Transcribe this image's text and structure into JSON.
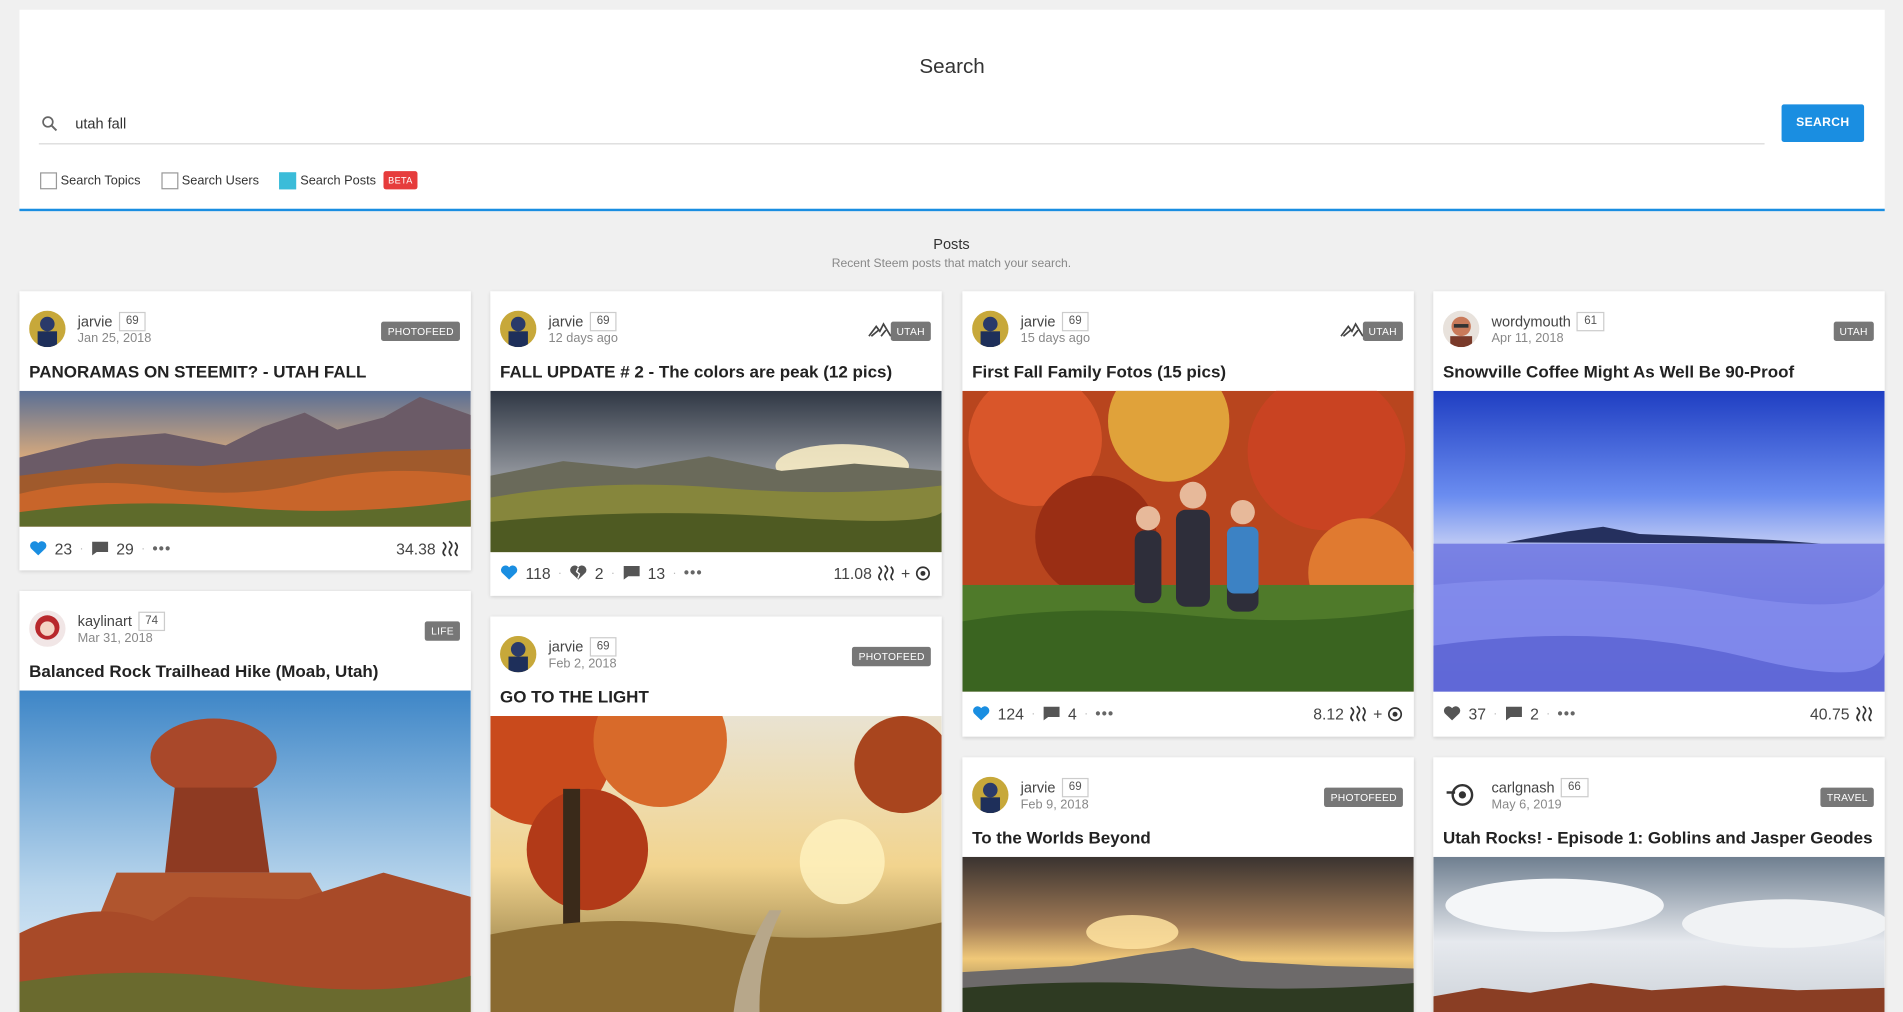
{
  "search": {
    "title": "Search",
    "query": "utah fall",
    "button_label": "SEARCH",
    "filters": [
      {
        "label": "Search Topics",
        "checked": false
      },
      {
        "label": "Search Users",
        "checked": false
      },
      {
        "label": "Search Posts",
        "checked": true,
        "badge": "BETA"
      }
    ]
  },
  "posts_section": {
    "title": "Posts",
    "subtitle": "Recent Steem posts that match your search."
  },
  "cards": [
    {
      "author": "jarvie",
      "rep": "69",
      "date": "Jan 25, 2018",
      "tag": "PHOTOFEED",
      "title": "PANORAMAS ON STEEMIT? - UTAH FALL",
      "votes": "23",
      "comments": "29",
      "payout": "34.38"
    },
    {
      "author": "jarvie",
      "rep": "69",
      "date": "12 days ago",
      "tag": "UTAH",
      "title": "FALL UPDATE # 2 - The colors are peak (12 pics)",
      "votes": "118",
      "downvotes": "2",
      "comments": "13",
      "payout": "11.08"
    },
    {
      "author": "jarvie",
      "rep": "69",
      "date": "15 days ago",
      "tag": "UTAH",
      "title": "First Fall Family Fotos (15 pics)",
      "votes": "124",
      "comments": "4",
      "payout": "8.12"
    },
    {
      "author": "wordymouth",
      "rep": "61",
      "date": "Apr 11, 2018",
      "tag": "UTAH",
      "title": "Snowville Coffee Might As Well Be 90-Proof",
      "votes": "37",
      "comments": "2",
      "payout": "40.75"
    },
    {
      "author": "kaylinart",
      "rep": "74",
      "date": "Mar 31, 2018",
      "tag": "LIFE",
      "title": "Balanced Rock Trailhead Hike (Moab, Utah)"
    },
    {
      "author": "jarvie",
      "rep": "69",
      "date": "Feb 2, 2018",
      "tag": "PHOTOFEED",
      "title": "GO TO THE LIGHT"
    },
    {
      "author": "jarvie",
      "rep": "69",
      "date": "Feb 9, 2018",
      "tag": "PHOTOFEED",
      "title": "To the Worlds Beyond"
    },
    {
      "author": "carlgnash",
      "rep": "66",
      "date": "May 6, 2019",
      "tag": "TRAVEL",
      "title": "Utah Rocks! - Episode 1: Goblins and Jasper Geodes"
    }
  ],
  "colors": {
    "accent": "#1a8ee1",
    "tag_bg": "#777777",
    "beta": "#e63c3c",
    "checked": "#3bbcd9"
  },
  "icons": [
    "search-icon",
    "heart-icon",
    "broken-heart-icon",
    "comment-icon",
    "more-icon",
    "steem-icon",
    "steem-power-icon",
    "community-icon"
  ]
}
